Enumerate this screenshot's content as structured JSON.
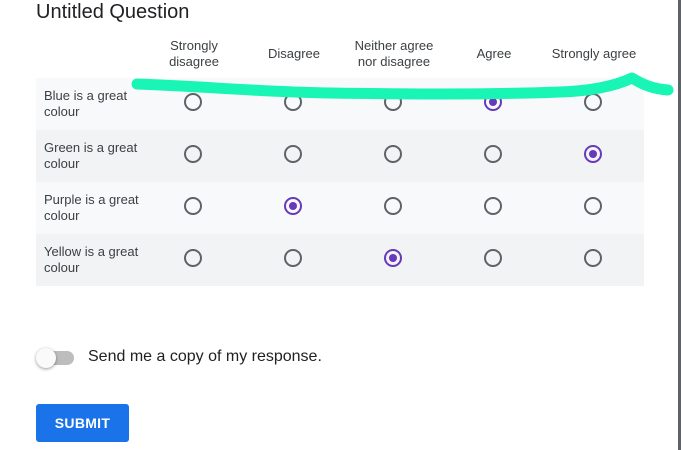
{
  "question": {
    "title": "Untitled Question"
  },
  "grid": {
    "columns": [
      "Strongly disagree",
      "Disagree",
      "Neither agree nor disagree",
      "Agree",
      "Strongly agree"
    ],
    "rows": [
      {
        "label": "Blue is a great colour",
        "selected": 3
      },
      {
        "label": "Green is a great colour",
        "selected": 4
      },
      {
        "label": "Purple is a great colour",
        "selected": 1
      },
      {
        "label": "Yellow is a great colour",
        "selected": 2
      }
    ]
  },
  "copy_toggle": {
    "label": "Send me a copy of my response.",
    "on": false
  },
  "submit": {
    "label": "SUBMIT"
  },
  "colors": {
    "accent": "#673ab7",
    "submit": "#1a73e8",
    "annotation": "#19f5b4"
  }
}
